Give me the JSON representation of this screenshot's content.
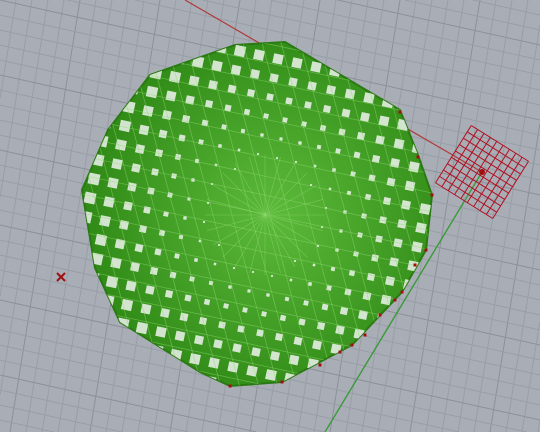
{
  "viewport": {
    "view": "perspective",
    "background_color": "#a9aeb6",
    "grid_line_color": "#989ea7",
    "grid_major_color": "#8b9099",
    "x_axis_color": "#b03a3a",
    "y_axis_color": "#3a9a3a",
    "mesh_color": "#3b9a1c",
    "mesh_highlight_color": "#8fd870",
    "selection_grid_color": "#b01020",
    "point_marker_color": "#a01010"
  }
}
